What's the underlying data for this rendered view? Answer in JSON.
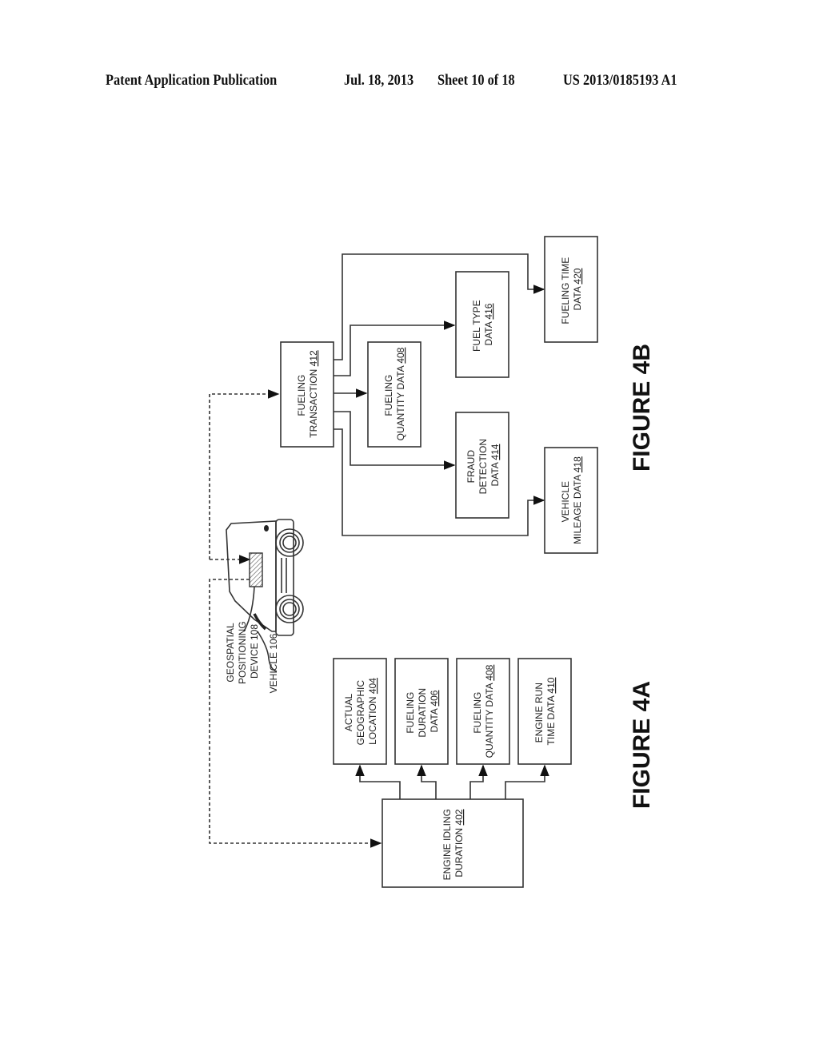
{
  "header": {
    "publication": "Patent Application Publication",
    "date": "Jul. 18, 2013",
    "sheet": "Sheet 10 of 18",
    "number": "US 2013/0185193 A1"
  },
  "figure_4a": {
    "caption": "FIGURE 4A",
    "source": {
      "lines": [
        "ENGINE IDLING",
        "DURATION"
      ],
      "ref": "402"
    },
    "outputs": [
      {
        "lines": [
          "ACTUAL",
          "GEOGRAPHIC",
          "LOCATION"
        ],
        "ref": "404"
      },
      {
        "lines": [
          "FUELING",
          "DURATION",
          "DATA"
        ],
        "ref": "406"
      },
      {
        "lines": [
          "FUELING",
          "QUANTITY DATA"
        ],
        "ref": "408"
      },
      {
        "lines": [
          "ENGINE RUN",
          "TIME DATA"
        ],
        "ref": "410"
      }
    ]
  },
  "vehicle": {
    "device_label": [
      "GEOSPATIAL",
      "POSITIONING",
      "DEVICE 108"
    ],
    "vehicle_label": "VEHICLE 106"
  },
  "figure_4b": {
    "caption": "FIGURE 4B",
    "source": {
      "lines": [
        "FUELING",
        "TRANSACTION"
      ],
      "ref": "412"
    },
    "outputs": [
      {
        "lines": [
          "FUELING",
          "QUANTITY DATA"
        ],
        "ref": "408"
      },
      {
        "lines": [
          "FUEL TYPE",
          "DATA"
        ],
        "ref": "416"
      },
      {
        "lines": [
          "FRAUD",
          "DETECTION",
          "DATA"
        ],
        "ref": "414"
      },
      {
        "lines": [
          "FUELING TIME",
          "DATA"
        ],
        "ref": "420"
      },
      {
        "lines": [
          "VEHICLE",
          "MILEAGE DATA"
        ],
        "ref": "418"
      }
    ]
  }
}
